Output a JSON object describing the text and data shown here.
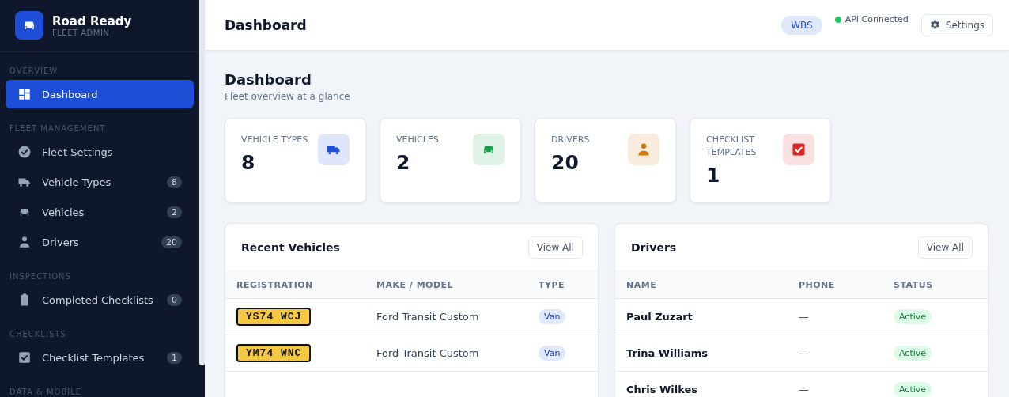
{
  "brand": {
    "title": "Road Ready",
    "subtitle": "FLEET ADMIN"
  },
  "sidebar": {
    "sections": [
      {
        "heading": "OVERVIEW",
        "items": [
          {
            "label": "Dashboard",
            "selected": true
          }
        ]
      },
      {
        "heading": "FLEET MANAGEMENT",
        "items": [
          {
            "label": "Fleet Settings",
            "selected": false
          },
          {
            "label": "Vehicle Types",
            "count": "8",
            "selected": false
          },
          {
            "label": "Vehicles",
            "count": "2",
            "selected": false
          },
          {
            "label": "Drivers",
            "count": "20",
            "selected": false
          }
        ]
      },
      {
        "heading": "INSPECTIONS",
        "items": [
          {
            "label": "Completed Checklists",
            "count": "0",
            "selected": false
          }
        ]
      },
      {
        "heading": "CHECKLISTS",
        "items": [
          {
            "label": "Checklist Templates",
            "count": "1",
            "selected": false
          }
        ]
      },
      {
        "heading": "DATA & MOBILE"
      }
    ]
  },
  "header": {
    "title": "Dashboard",
    "org_badge": "WBS",
    "api_status": "API Connected",
    "settings_button": "Settings"
  },
  "page": {
    "title": "Dashboard",
    "subtitle": "Fleet overview at a glance"
  },
  "stats": [
    {
      "label": "VEHICLE TYPES",
      "value": "8",
      "color": "#1d4ed8"
    },
    {
      "label": "VEHICLES",
      "value": "2",
      "color": "#16a34a"
    },
    {
      "label": "DRIVERS",
      "value": "20",
      "color": "#d97706"
    },
    {
      "label": "CHECKLIST TEMPLATES",
      "value": "1",
      "color": "#dc2626"
    }
  ],
  "recent_vehicles": {
    "title": "Recent Vehicles",
    "button": "View All",
    "columns": [
      "REGISTRATION",
      "MAKE / MODEL",
      "TYPE"
    ],
    "rows": [
      {
        "registration": "YS74 WCJ",
        "make_model": "Ford Transit Custom",
        "type": "Van"
      },
      {
        "registration": "YM74 WNC",
        "make_model": "Ford Transit Custom",
        "type": "Van"
      }
    ]
  },
  "drivers": {
    "title": "Drivers",
    "button": "View All",
    "columns": [
      "NAME",
      "PHONE",
      "STATUS"
    ],
    "rows": [
      {
        "name": "Paul Zuzart",
        "phone": "—",
        "status": "Active"
      },
      {
        "name": "Trina Williams",
        "phone": "—",
        "status": "Active"
      },
      {
        "name": "Chris Wilkes",
        "phone": "—",
        "status": "Active"
      }
    ]
  }
}
